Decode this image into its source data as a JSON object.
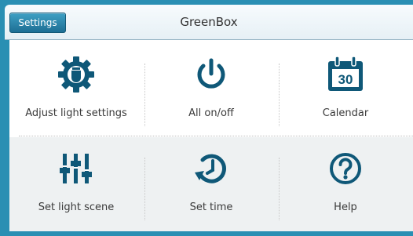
{
  "header": {
    "settings_label": "Settings",
    "title": "GreenBox"
  },
  "colors": {
    "accent": "#1e7fa6",
    "icon": "#0f5878"
  },
  "tiles": [
    {
      "label": "Adjust light settings",
      "icon": "gear-bulb-icon"
    },
    {
      "label": "All on/off",
      "icon": "power-icon"
    },
    {
      "label": "Calendar",
      "icon": "calendar-icon",
      "day": "30"
    },
    {
      "label": "Set light scene",
      "icon": "sliders-icon"
    },
    {
      "label": "Set time",
      "icon": "clock-icon"
    },
    {
      "label": "Help",
      "icon": "help-icon"
    }
  ]
}
